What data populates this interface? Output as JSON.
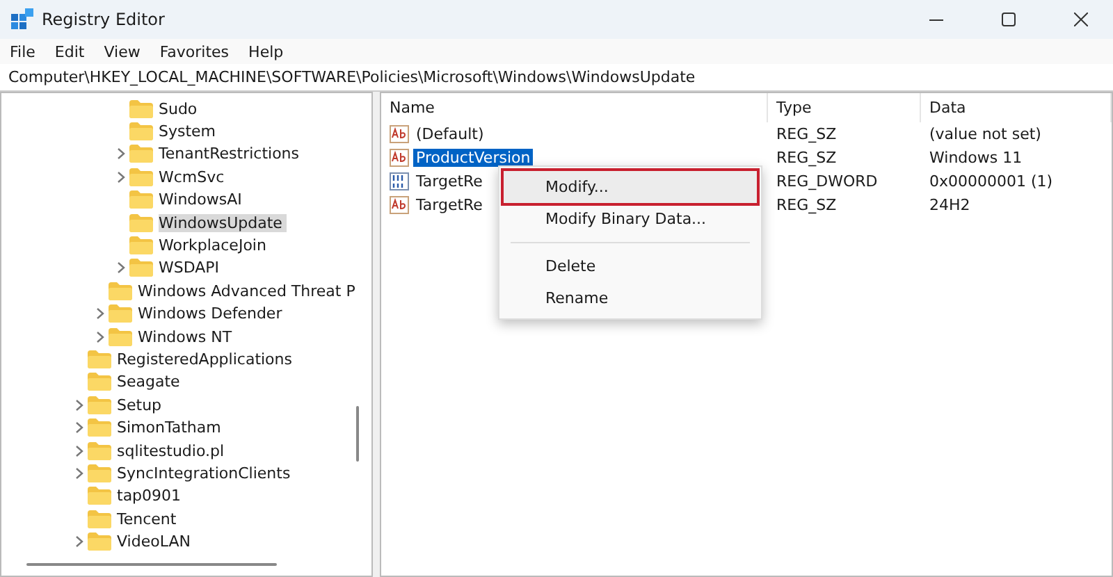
{
  "window": {
    "title": "Registry Editor"
  },
  "menu": [
    "File",
    "Edit",
    "View",
    "Favorites",
    "Help"
  ],
  "address": "Computer\\HKEY_LOCAL_MACHINE\\SOFTWARE\\Policies\\Microsoft\\Windows\\WindowsUpdate",
  "tree": [
    {
      "children": [
        {
          "children": [
            {
              "label": "Sudo",
              "expandable": false,
              "selected": false
            },
            {
              "label": "System",
              "expandable": false,
              "selected": false
            },
            {
              "label": "TenantRestrictions",
              "expandable": true,
              "selected": false
            },
            {
              "label": "WcmSvc",
              "expandable": true,
              "selected": false
            },
            {
              "label": "WindowsAI",
              "expandable": false,
              "selected": false
            },
            {
              "label": "WindowsUpdate",
              "expandable": false,
              "selected": true
            },
            {
              "label": "WorkplaceJoin",
              "expandable": false,
              "selected": false
            },
            {
              "label": "WSDAPI",
              "expandable": true,
              "selected": false
            }
          ]
        },
        {
          "label": "Windows Advanced Threat P",
          "expandable": false,
          "selected": false
        },
        {
          "label": "Windows Defender",
          "expandable": true,
          "selected": false
        },
        {
          "label": "Windows NT",
          "expandable": true,
          "selected": false
        }
      ]
    },
    {
      "label": "RegisteredApplications",
      "expandable": false,
      "selected": false
    },
    {
      "label": "Seagate",
      "expandable": false,
      "selected": false
    },
    {
      "label": "Setup",
      "expandable": true,
      "selected": false
    },
    {
      "label": "SimonTatham",
      "expandable": true,
      "selected": false
    },
    {
      "label": "sqlitestudio.pl",
      "expandable": true,
      "selected": false
    },
    {
      "label": "SyncIntegrationClients",
      "expandable": true,
      "selected": false
    },
    {
      "label": "tap0901",
      "expandable": false,
      "selected": false
    },
    {
      "label": "Tencent",
      "expandable": false,
      "selected": false
    },
    {
      "label": "VideoLAN",
      "expandable": true,
      "selected": false
    }
  ],
  "values": {
    "columns": [
      "Name",
      "Type",
      "Data"
    ],
    "rows": [
      {
        "name": "(Default)",
        "kind": "string",
        "type": "REG_SZ",
        "data": "(value not set)",
        "selected": false
      },
      {
        "name": "ProductVersion",
        "kind": "string",
        "type": "REG_SZ",
        "data": "Windows 11",
        "selected": true
      },
      {
        "name": "TargetRe",
        "kind": "binary",
        "type": "REG_DWORD",
        "data": "0x00000001 (1)",
        "selected": false
      },
      {
        "name": "TargetRe",
        "kind": "string",
        "type": "REG_SZ",
        "data": "24H2",
        "selected": false
      }
    ]
  },
  "context_menu": [
    {
      "kind": "item",
      "label": "Modify...",
      "highlighted": true
    },
    {
      "kind": "item",
      "label": "Modify Binary Data...",
      "highlighted": false
    },
    {
      "kind": "separator"
    },
    {
      "kind": "item",
      "label": "Delete",
      "highlighted": false
    },
    {
      "kind": "item",
      "label": "Rename",
      "highlighted": false
    }
  ]
}
